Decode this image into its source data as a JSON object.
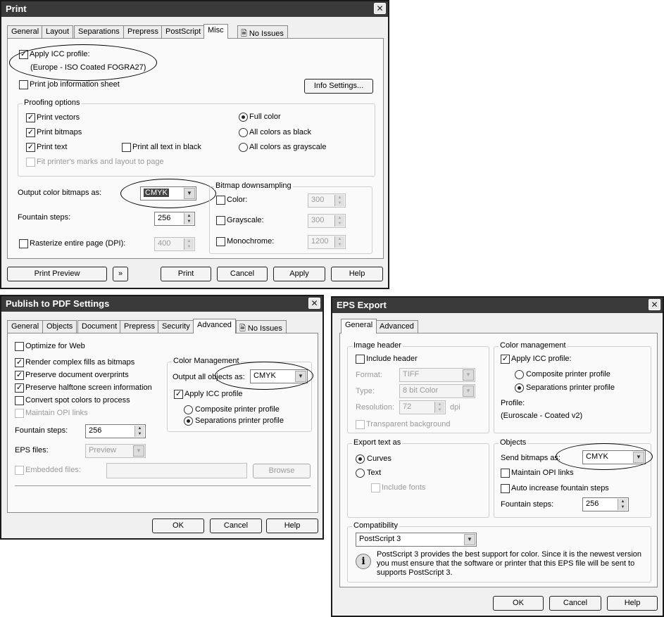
{
  "print": {
    "title": "Print",
    "close": "✕",
    "tabs": [
      "General",
      "Layout",
      "Separations",
      "Prepress",
      "PostScript",
      "Misc",
      "No Issues"
    ],
    "apply_icc_label": "Apply ICC profile:",
    "icc_profile": "(Europe - ISO Coated FOGRA27)",
    "print_job_sheet_label": "Print job information sheet",
    "info_settings_button": "Info Settings...",
    "proofing_title": "Proofing options",
    "print_vectors": "Print vectors",
    "print_bitmaps": "Print bitmaps",
    "print_text": "Print text",
    "print_all_text_black": "Print all text in black",
    "fit_printer_marks": "Fit printer's marks and layout to page",
    "full_color": "Full color",
    "all_colors_black": "All colors as black",
    "all_colors_grayscale": "All colors as grayscale",
    "output_color_bitmaps_label": "Output color bitmaps as:",
    "output_color_value": "CMYK",
    "fountain_steps_label": "Fountain steps:",
    "fountain_steps_value": "256",
    "rasterize_label": "Rasterize entire page (DPI):",
    "rasterize_value": "400",
    "bitmap_downsampling_title": "Bitmap downsampling",
    "ds_color": "Color:",
    "ds_color_value": "300",
    "ds_grayscale": "Grayscale:",
    "ds_grayscale_value": "300",
    "ds_mono": "Monochrome:",
    "ds_mono_value": "1200",
    "print_preview_button": "Print Preview",
    "print_button": "Print",
    "cancel_button": "Cancel",
    "apply_button": "Apply",
    "help_button": "Help"
  },
  "pdf": {
    "title": "Publish to PDF Settings",
    "close": "✕",
    "tabs": [
      "General",
      "Objects",
      "Document",
      "Prepress",
      "Security",
      "Advanced",
      "No Issues"
    ],
    "optimize_web": "Optimize for Web",
    "render_complex": "Render complex fills as bitmaps",
    "preserve_overprints": "Preserve document overprints",
    "preserve_halftone": "Preserve halftone screen information",
    "convert_spot": "Convert spot colors to process",
    "maintain_opi": "Maintain OPI links",
    "fountain_steps_label": "Fountain steps:",
    "fountain_steps_value": "256",
    "eps_files_label": "EPS files:",
    "eps_files_value": "Preview",
    "embedded_files_label": "Embedded files:",
    "browse_button": "Browse",
    "color_mgmt_title": "Color Management",
    "output_all_objects_label": "Output all objects as:",
    "output_all_objects_value": "CMYK",
    "apply_icc_label": "Apply ICC profile",
    "composite_profile": "Composite printer profile",
    "separations_profile": "Separations printer profile",
    "ok_button": "OK",
    "cancel_button": "Cancel",
    "help_button": "Help"
  },
  "eps": {
    "title": "EPS Export",
    "close": "✕",
    "tabs": [
      "General",
      "Advanced"
    ],
    "image_header_title": "Image header",
    "include_header": "Include header",
    "format_label": "Format:",
    "format_value": "TIFF",
    "type_label": "Type:",
    "type_value": "8 bit Color",
    "resolution_label": "Resolution:",
    "resolution_value": "72",
    "dpi_unit": "dpi",
    "transparent_bg": "Transparent background",
    "export_text_title": "Export text as",
    "curves": "Curves",
    "text": "Text",
    "include_fonts": "Include fonts",
    "color_mgmt_title": "Color management",
    "apply_icc_label": "Apply ICC profile:",
    "composite_profile": "Composite printer profile",
    "separations_profile": "Separations printer profile",
    "profile_label": "Profile:",
    "profile_value": "(Euroscale - Coated v2)",
    "objects_title": "Objects",
    "send_bitmaps_label": "Send bitmaps as:",
    "send_bitmaps_value": "CMYK",
    "maintain_opi": "Maintain OPI links",
    "auto_increase": "Auto increase fountain steps",
    "fountain_steps_label": "Fountain steps:",
    "fountain_steps_value": "256",
    "compat_title": "Compatibility",
    "compat_value": "PostScript 3",
    "compat_info": "PostScript 3 provides the best support for color. Since it is the newest version you must ensure that the software or printer that this EPS file will be sent to supports PostScript 3.",
    "ok_button": "OK",
    "cancel_button": "Cancel",
    "help_button": "Help"
  }
}
